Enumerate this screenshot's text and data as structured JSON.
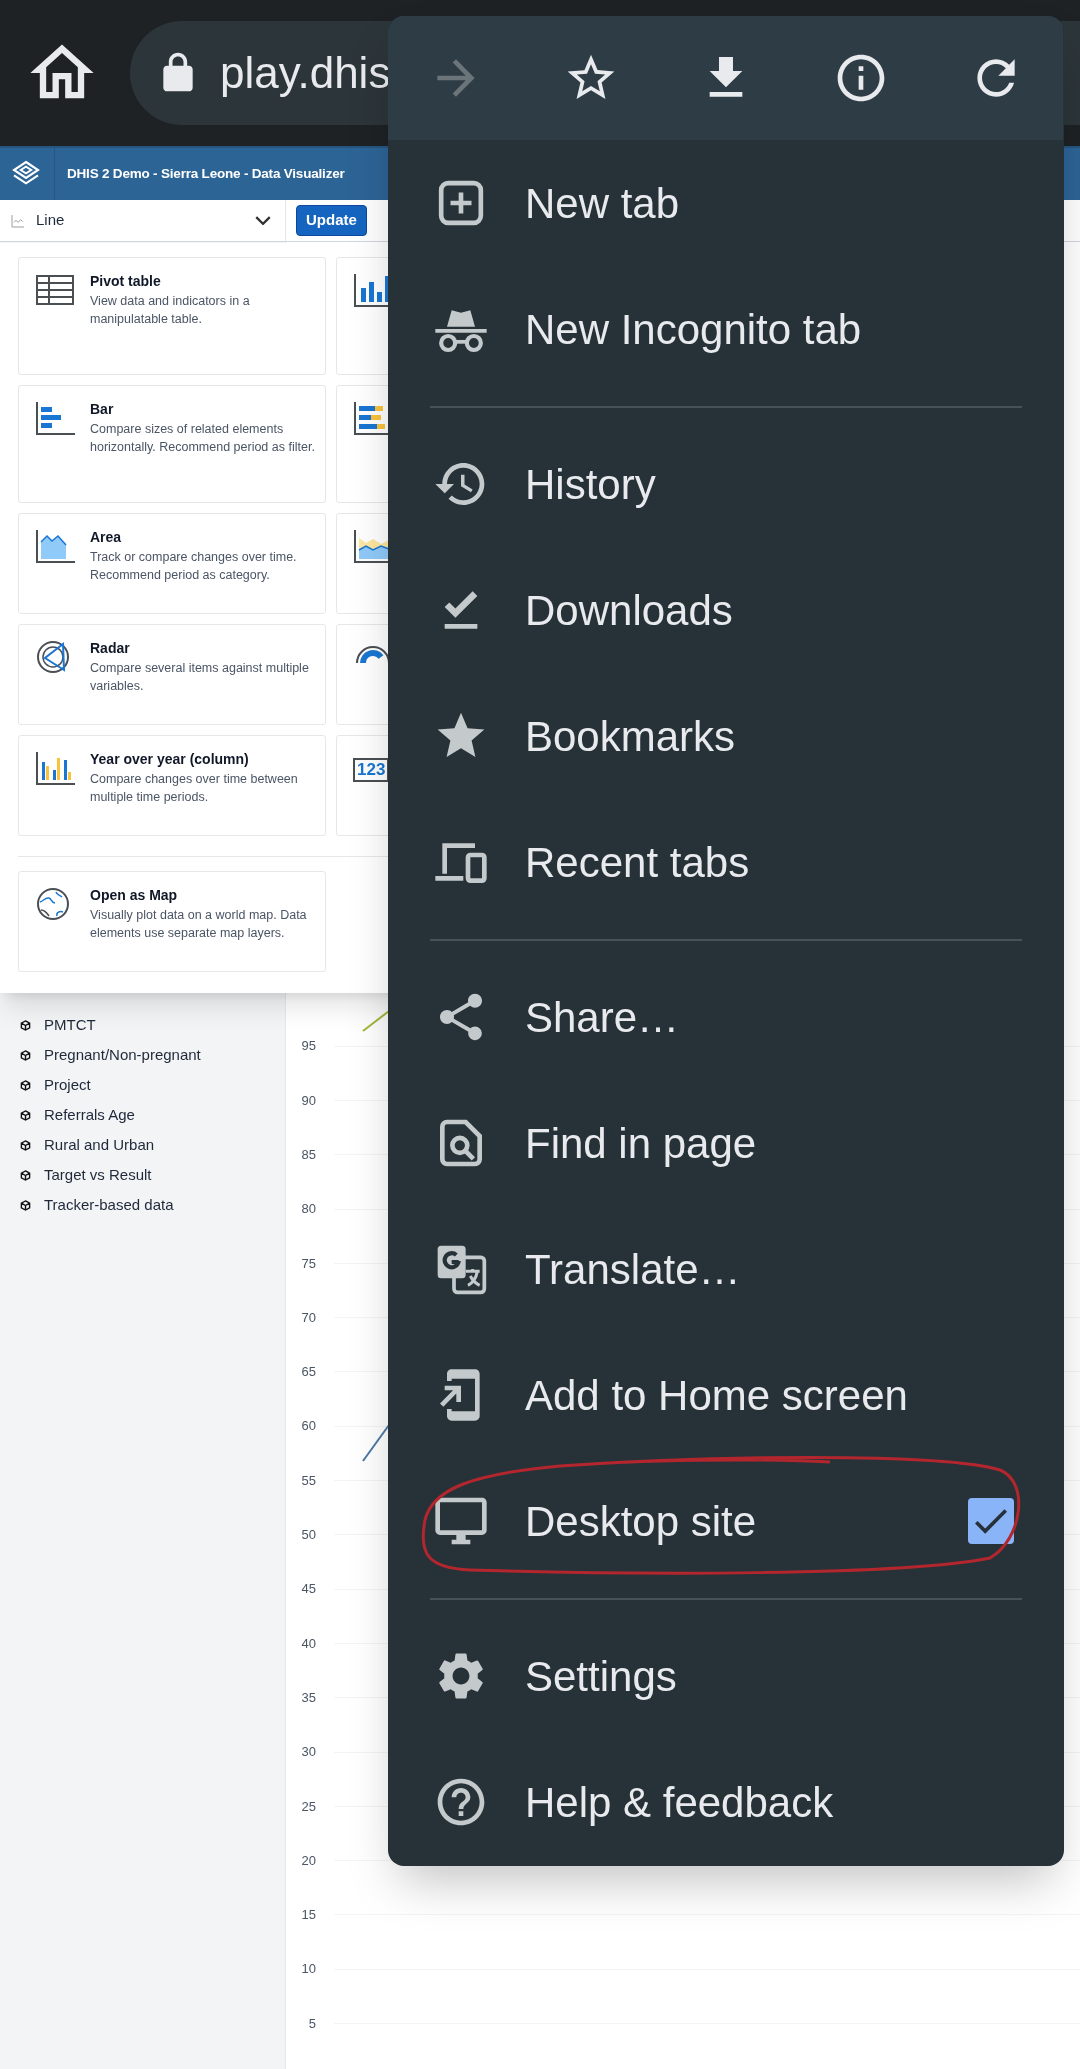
{
  "browser": {
    "url": "play.dhis"
  },
  "app": {
    "title": "DHIS 2 Demo - Sierra Leone - Data Visualizer",
    "chart_type": "Line",
    "update_button": "Update"
  },
  "chart_types": [
    {
      "kind": "pivot",
      "title": "Pivot table",
      "description": "View data and indicators in a manipulatable table."
    },
    {
      "kind": "bar",
      "title": "Bar",
      "description": "Compare sizes of related elements horizontally. Recommend period as filter."
    },
    {
      "kind": "area",
      "title": "Area",
      "description": "Track or compare changes over time. Recommend period as category."
    },
    {
      "kind": "radar",
      "title": "Radar",
      "description": "Compare several items against multiple variables."
    },
    {
      "kind": "yoy",
      "title": "Year over year (column)",
      "description": "Compare changes over time between multiple time periods."
    }
  ],
  "chart_types_right": [
    {
      "kind": "column"
    },
    {
      "kind": "stacked-bar"
    },
    {
      "kind": "stacked-area"
    },
    {
      "kind": "gauge"
    },
    {
      "kind": "single-value",
      "text": "123"
    }
  ],
  "map_option": {
    "title": "Open as Map",
    "description": "Visually plot data on a world map. Data elements use separate map layers."
  },
  "sidebar": {
    "items": [
      "PMTCT",
      "Pregnant/Non-pregnant",
      "Project",
      "Referrals Age",
      "Rural and Urban",
      "Target vs Result",
      "Tracker-based data"
    ]
  },
  "y_axis_labels": [
    "95",
    "90",
    "85",
    "80",
    "75",
    "70",
    "65",
    "60",
    "55",
    "50",
    "45",
    "40",
    "35",
    "30",
    "25",
    "20",
    "15",
    "10",
    "5"
  ],
  "menu": {
    "toolbar": [
      {
        "disabled": true
      },
      {
        "disabled": false
      },
      {
        "disabled": false
      },
      {
        "disabled": false
      },
      {
        "disabled": false
      }
    ],
    "groups": [
      [
        {
          "kind": "action",
          "label": "New tab"
        },
        {
          "kind": "action",
          "label": "New Incognito tab"
        }
      ],
      [
        {
          "kind": "action",
          "label": "History"
        },
        {
          "kind": "action",
          "label": "Downloads"
        },
        {
          "kind": "action",
          "label": "Bookmarks"
        },
        {
          "kind": "action",
          "label": "Recent tabs"
        }
      ],
      [
        {
          "kind": "action",
          "label": "Share…"
        },
        {
          "kind": "action",
          "label": "Find in page"
        },
        {
          "kind": "action",
          "label": "Translate…"
        },
        {
          "kind": "action",
          "label": "Add to Home screen"
        },
        {
          "kind": "checkbox",
          "label": "Desktop site",
          "checked": true
        }
      ],
      [
        {
          "kind": "action",
          "label": "Settings"
        },
        {
          "kind": "action",
          "label": "Help & feedback"
        }
      ]
    ]
  }
}
